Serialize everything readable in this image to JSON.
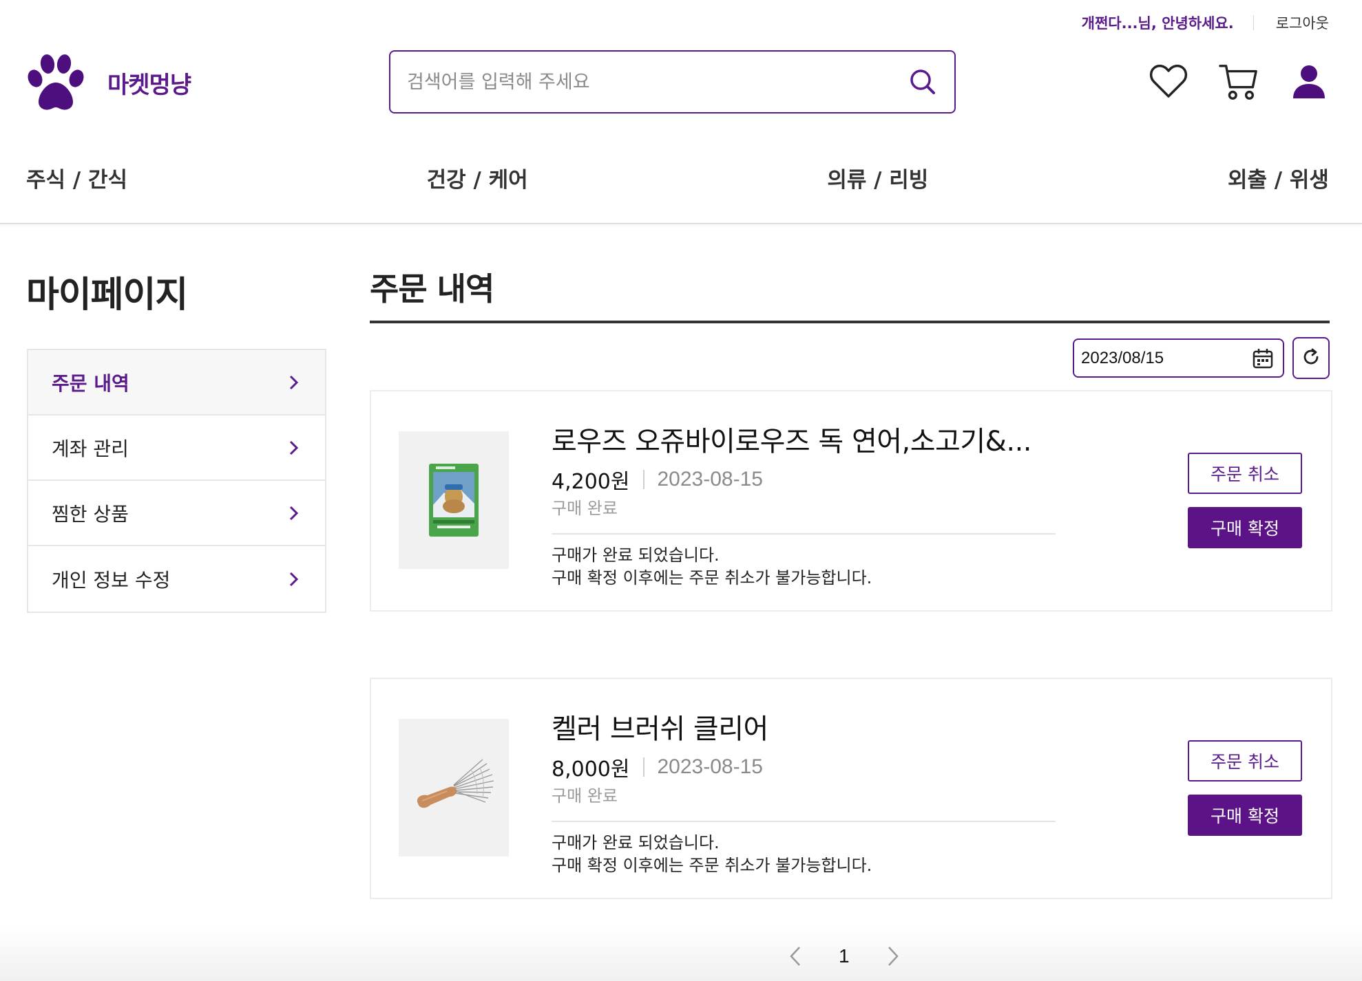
{
  "header": {
    "greeting": "개쩐다...님, 안녕하세요.",
    "logout_label": "로그아웃",
    "logo_text": "마켓멍냥",
    "logo_icon": "paw-icon",
    "search": {
      "placeholder": "검색어를 입력해 주세요",
      "value": ""
    },
    "icons": [
      "heart-icon",
      "cart-icon",
      "user-icon"
    ],
    "brand_color": "#5a1a8c"
  },
  "nav": {
    "items": [
      {
        "label": "주식 / 간식"
      },
      {
        "label": "건강 / 케어"
      },
      {
        "label": "의류 / 리빙"
      },
      {
        "label": "외출 / 위생"
      }
    ]
  },
  "sidebar": {
    "title": "마이페이지",
    "items": [
      {
        "label": "주문 내역",
        "active": true
      },
      {
        "label": "계좌 관리",
        "active": false
      },
      {
        "label": "찜한 상품",
        "active": false
      },
      {
        "label": "개인 정보 수정",
        "active": false
      }
    ]
  },
  "main": {
    "title": "주문 내역",
    "date_filter": "2023/08/15",
    "orders": [
      {
        "name": "로우즈 오쥬바이로우즈 독 연어,소고기&...",
        "price": "4,200원",
        "date": "2023-08-15",
        "status": "구매 완료",
        "notice_line1": "구매가 완료 되었습니다.",
        "notice_line2": "구매 확정 이후에는 주문 취소가 불가능합니다.",
        "cancel_label": "주문 취소",
        "confirm_label": "구매 확정"
      },
      {
        "name": "켈러 브러쉬 클리어",
        "price": "8,000원",
        "date": "2023-08-15",
        "status": "구매 완료",
        "notice_line1": "구매가 완료 되었습니다.",
        "notice_line2": "구매 확정 이후에는 주문 취소가 불가능합니다.",
        "cancel_label": "주문 취소",
        "confirm_label": "구매 확정"
      }
    ]
  },
  "pagination": {
    "current_page": "1"
  }
}
